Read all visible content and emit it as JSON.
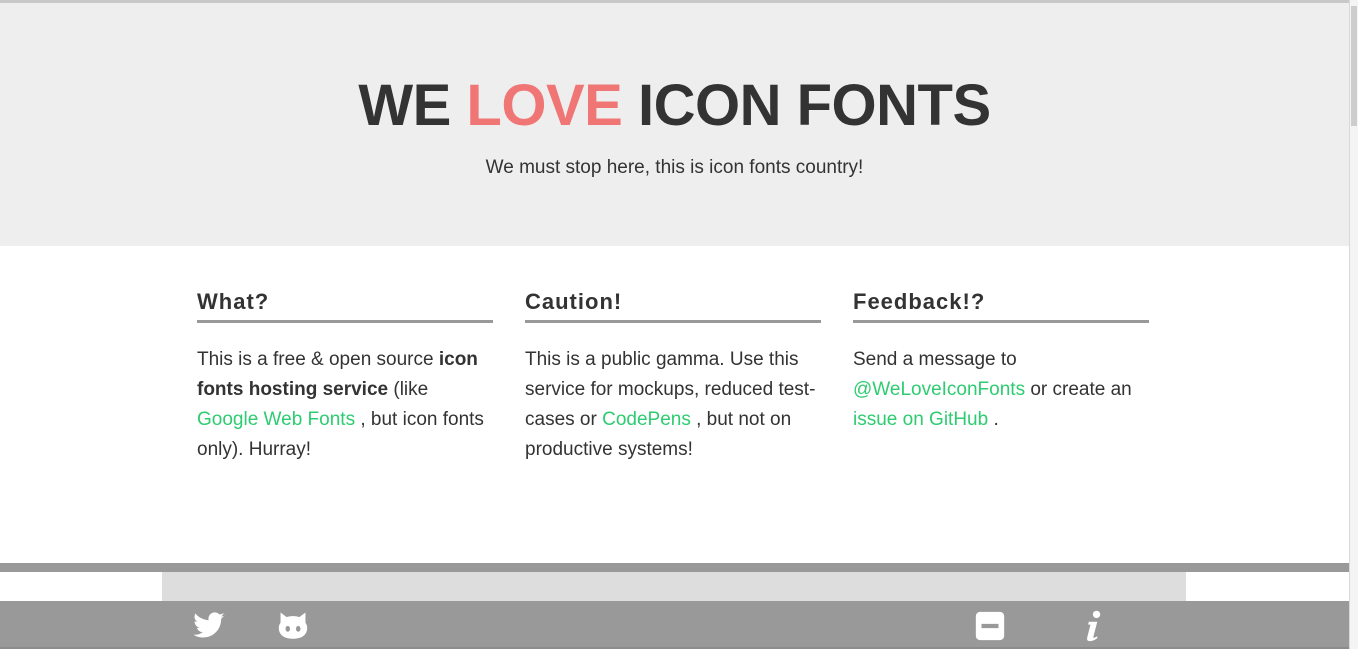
{
  "hero": {
    "title_part1": "WE",
    "title_love": "LOVE",
    "title_part2": "ICON FONTS",
    "subtitle": "We must stop here, this is icon fonts country!"
  },
  "columns": [
    {
      "heading": "What?",
      "text_1": "This is a free & open source ",
      "bold": "icon fonts hosting service",
      "text_2": " (like ",
      "link": "Google Web Fonts",
      "text_3": " , but icon fonts only). Hurray!"
    },
    {
      "heading": "Caution!",
      "text_1": "This is a public gamma. Use this service for mockups, reduced test-cases or ",
      "link": "CodePens",
      "text_2": " , but not on productive systems!"
    },
    {
      "heading": "Feedback!?",
      "text_1": "Send a message to ",
      "link_1": "@WeLoveIconFonts",
      "text_2": " or create an ",
      "link_2": "issue on GitHub",
      "text_3": " ."
    }
  ],
  "footer": {
    "icons": [
      "twitter-icon",
      "github-icon",
      "minus-icon",
      "info-icon"
    ]
  },
  "colors": {
    "accent_love": "#ef7674",
    "link_green": "#2ecc71",
    "hero_bg": "#eeeeee",
    "footer_gray": "#999999"
  }
}
